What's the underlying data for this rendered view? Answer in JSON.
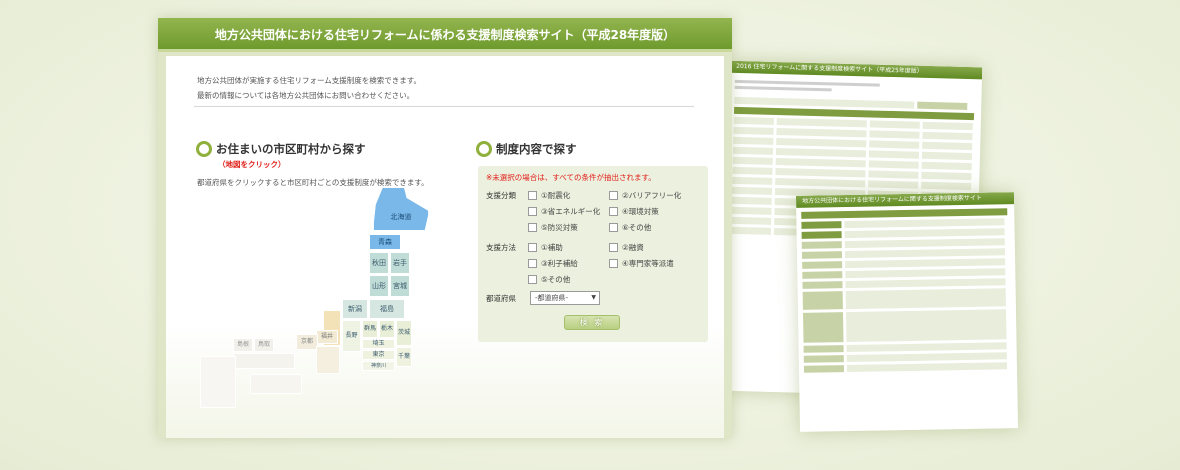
{
  "header": {
    "title": "地方公共団体における住宅リフォームに係わる支援制度検索サイト（平成28年度版）"
  },
  "intro": {
    "line1": "地方公共団体が実施する住宅リフォーム支援制度を検索できます。",
    "line2": "最新の情報については各地方公共団体にお問い合わせください。"
  },
  "map_section": {
    "title": "お住まいの市区町村から探す",
    "click_note": "（地図をクリック）",
    "description": "都道府県をクリックすると市区町村ごとの支援制度が検索できます。",
    "prefectures": {
      "hokkaido": "北海道",
      "aomori": "青森",
      "akita": "秋田",
      "iwate": "岩手",
      "yamagata": "山形",
      "miyagi": "宮城",
      "niigata": "新潟",
      "fukushima": "福島",
      "gunma": "群馬",
      "tochigi": "栃木",
      "ibaraki": "茨城",
      "saitama": "埼玉",
      "chiba": "千葉",
      "nagano": "長野",
      "tokyo": "東京",
      "kanagawa": "神奈川",
      "fukui": "福井",
      "kyoto": "京都",
      "tottori": "鳥取",
      "shimane": "島根"
    }
  },
  "search_section": {
    "title": "制度内容で探す",
    "warning": "※未選択の場合は、すべての条件が抽出されます。",
    "category_label": "支援分類",
    "category_options": [
      "①耐震化",
      "②バリアフリー化",
      "③省エネルギー化",
      "④環境対策",
      "⑤防災対策",
      "⑥その他"
    ],
    "method_label": "支援方法",
    "method_options": [
      "①補助",
      "②融資",
      "③利子補給",
      "④専門家等派遣",
      "⑤その他"
    ],
    "prefecture_label": "都道府県",
    "prefecture_select": "-都道府県-",
    "search_button": "検 索"
  },
  "background_shots": {
    "shot2_title": "2016 住宅リフォームに関する支援制度検索サイト（平成25年度版）",
    "shot3_title": "地方公共団体における住宅リフォームに関する支援制度検索サイト"
  },
  "colors": {
    "accent_green": "#6e9a2d",
    "warning_red": "#e0201b",
    "map_blue": "#79b8e8",
    "map_teal": "#bfdcd6"
  }
}
